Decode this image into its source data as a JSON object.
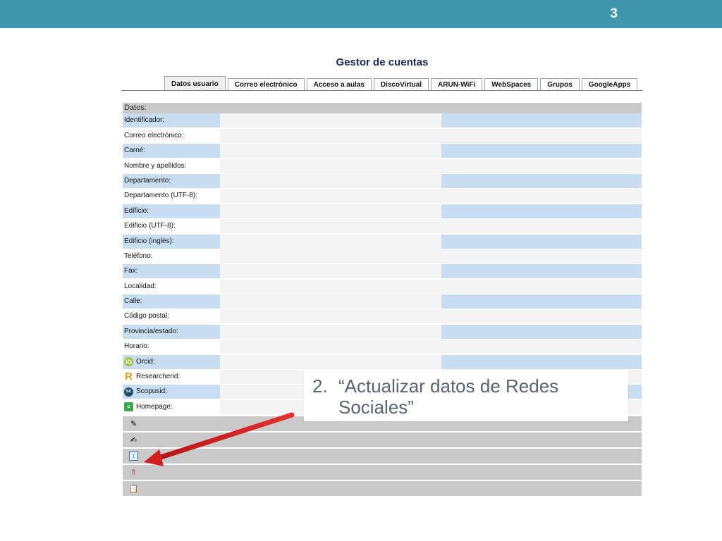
{
  "slide": {
    "number": "3"
  },
  "page_title": "Gestor de cuentas",
  "tabs": [
    {
      "label": "Datos usuario",
      "active": true
    },
    {
      "label": "Correo electrónico"
    },
    {
      "label": "Acceso a aulas"
    },
    {
      "label": "DiscoVirtual"
    },
    {
      "label": "ARUN-WiFi"
    },
    {
      "label": "WebSpaces"
    },
    {
      "label": "Grupos"
    },
    {
      "label": "GoogleApps"
    }
  ],
  "section": {
    "title": "Datos:"
  },
  "fields": [
    {
      "label": "Identificador:"
    },
    {
      "label": "Correo electrónico:"
    },
    {
      "label": "Carné:"
    },
    {
      "label": "Nombre y apellidos:"
    },
    {
      "label": "Departamento:"
    },
    {
      "label": "Departamento (UTF-8):"
    },
    {
      "label": "Edificio:"
    },
    {
      "label": "Edificio (UTF-8):"
    },
    {
      "label": "Edificio (inglés):"
    },
    {
      "label": "Teléfono:"
    },
    {
      "label": "Fax:"
    },
    {
      "label": "Localidad:"
    },
    {
      "label": "Calle:"
    },
    {
      "label": "Código postal:"
    },
    {
      "label": "Provincia/estado:"
    },
    {
      "label": "Horario:"
    },
    {
      "label": "Orcid:",
      "icon": "orcid-icon"
    },
    {
      "label": "Researcherid:",
      "icon": "researcherid-icon"
    },
    {
      "label": "Scopusid:",
      "icon": "scopus-icon"
    },
    {
      "label": "Homepage:",
      "icon": "homepage-share-icon"
    }
  ],
  "actions": [
    {
      "icon": "edit-pencil-icon"
    },
    {
      "icon": "edit-document-icon"
    },
    {
      "icon": "social-networks-icon",
      "highlighted": true
    },
    {
      "icon": "upload-document-icon"
    },
    {
      "icon": "clipboard-icon"
    }
  ],
  "callout": {
    "number": "2.",
    "text": "“Actualizar datos de Redes Sociales”"
  },
  "colors": {
    "topbar": "#3f97ae",
    "row_blue": "#c8ddf0",
    "section_gray": "#c9c9c9",
    "arrow": "#e02020",
    "title": "#1a2a55"
  }
}
